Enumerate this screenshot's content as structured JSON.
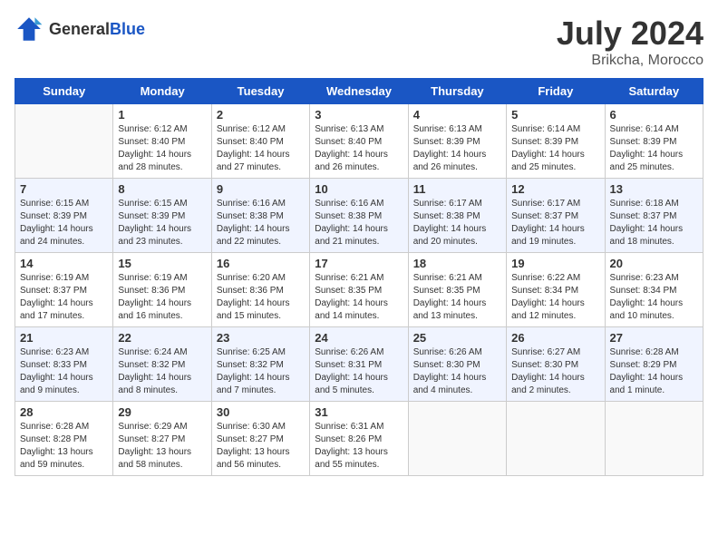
{
  "header": {
    "logo_general": "General",
    "logo_blue": "Blue",
    "month_year": "July 2024",
    "location": "Brikcha, Morocco"
  },
  "weekdays": [
    "Sunday",
    "Monday",
    "Tuesday",
    "Wednesday",
    "Thursday",
    "Friday",
    "Saturday"
  ],
  "weeks": [
    [
      {
        "day": "",
        "sunrise": "",
        "sunset": "",
        "daylight": ""
      },
      {
        "day": "1",
        "sunrise": "Sunrise: 6:12 AM",
        "sunset": "Sunset: 8:40 PM",
        "daylight": "Daylight: 14 hours and 28 minutes."
      },
      {
        "day": "2",
        "sunrise": "Sunrise: 6:12 AM",
        "sunset": "Sunset: 8:40 PM",
        "daylight": "Daylight: 14 hours and 27 minutes."
      },
      {
        "day": "3",
        "sunrise": "Sunrise: 6:13 AM",
        "sunset": "Sunset: 8:40 PM",
        "daylight": "Daylight: 14 hours and 26 minutes."
      },
      {
        "day": "4",
        "sunrise": "Sunrise: 6:13 AM",
        "sunset": "Sunset: 8:39 PM",
        "daylight": "Daylight: 14 hours and 26 minutes."
      },
      {
        "day": "5",
        "sunrise": "Sunrise: 6:14 AM",
        "sunset": "Sunset: 8:39 PM",
        "daylight": "Daylight: 14 hours and 25 minutes."
      },
      {
        "day": "6",
        "sunrise": "Sunrise: 6:14 AM",
        "sunset": "Sunset: 8:39 PM",
        "daylight": "Daylight: 14 hours and 25 minutes."
      }
    ],
    [
      {
        "day": "7",
        "sunrise": "Sunrise: 6:15 AM",
        "sunset": "Sunset: 8:39 PM",
        "daylight": "Daylight: 14 hours and 24 minutes."
      },
      {
        "day": "8",
        "sunrise": "Sunrise: 6:15 AM",
        "sunset": "Sunset: 8:39 PM",
        "daylight": "Daylight: 14 hours and 23 minutes."
      },
      {
        "day": "9",
        "sunrise": "Sunrise: 6:16 AM",
        "sunset": "Sunset: 8:38 PM",
        "daylight": "Daylight: 14 hours and 22 minutes."
      },
      {
        "day": "10",
        "sunrise": "Sunrise: 6:16 AM",
        "sunset": "Sunset: 8:38 PM",
        "daylight": "Daylight: 14 hours and 21 minutes."
      },
      {
        "day": "11",
        "sunrise": "Sunrise: 6:17 AM",
        "sunset": "Sunset: 8:38 PM",
        "daylight": "Daylight: 14 hours and 20 minutes."
      },
      {
        "day": "12",
        "sunrise": "Sunrise: 6:17 AM",
        "sunset": "Sunset: 8:37 PM",
        "daylight": "Daylight: 14 hours and 19 minutes."
      },
      {
        "day": "13",
        "sunrise": "Sunrise: 6:18 AM",
        "sunset": "Sunset: 8:37 PM",
        "daylight": "Daylight: 14 hours and 18 minutes."
      }
    ],
    [
      {
        "day": "14",
        "sunrise": "Sunrise: 6:19 AM",
        "sunset": "Sunset: 8:37 PM",
        "daylight": "Daylight: 14 hours and 17 minutes."
      },
      {
        "day": "15",
        "sunrise": "Sunrise: 6:19 AM",
        "sunset": "Sunset: 8:36 PM",
        "daylight": "Daylight: 14 hours and 16 minutes."
      },
      {
        "day": "16",
        "sunrise": "Sunrise: 6:20 AM",
        "sunset": "Sunset: 8:36 PM",
        "daylight": "Daylight: 14 hours and 15 minutes."
      },
      {
        "day": "17",
        "sunrise": "Sunrise: 6:21 AM",
        "sunset": "Sunset: 8:35 PM",
        "daylight": "Daylight: 14 hours and 14 minutes."
      },
      {
        "day": "18",
        "sunrise": "Sunrise: 6:21 AM",
        "sunset": "Sunset: 8:35 PM",
        "daylight": "Daylight: 14 hours and 13 minutes."
      },
      {
        "day": "19",
        "sunrise": "Sunrise: 6:22 AM",
        "sunset": "Sunset: 8:34 PM",
        "daylight": "Daylight: 14 hours and 12 minutes."
      },
      {
        "day": "20",
        "sunrise": "Sunrise: 6:23 AM",
        "sunset": "Sunset: 8:34 PM",
        "daylight": "Daylight: 14 hours and 10 minutes."
      }
    ],
    [
      {
        "day": "21",
        "sunrise": "Sunrise: 6:23 AM",
        "sunset": "Sunset: 8:33 PM",
        "daylight": "Daylight: 14 hours and 9 minutes."
      },
      {
        "day": "22",
        "sunrise": "Sunrise: 6:24 AM",
        "sunset": "Sunset: 8:32 PM",
        "daylight": "Daylight: 14 hours and 8 minutes."
      },
      {
        "day": "23",
        "sunrise": "Sunrise: 6:25 AM",
        "sunset": "Sunset: 8:32 PM",
        "daylight": "Daylight: 14 hours and 7 minutes."
      },
      {
        "day": "24",
        "sunrise": "Sunrise: 6:26 AM",
        "sunset": "Sunset: 8:31 PM",
        "daylight": "Daylight: 14 hours and 5 minutes."
      },
      {
        "day": "25",
        "sunrise": "Sunrise: 6:26 AM",
        "sunset": "Sunset: 8:30 PM",
        "daylight": "Daylight: 14 hours and 4 minutes."
      },
      {
        "day": "26",
        "sunrise": "Sunrise: 6:27 AM",
        "sunset": "Sunset: 8:30 PM",
        "daylight": "Daylight: 14 hours and 2 minutes."
      },
      {
        "day": "27",
        "sunrise": "Sunrise: 6:28 AM",
        "sunset": "Sunset: 8:29 PM",
        "daylight": "Daylight: 14 hours and 1 minute."
      }
    ],
    [
      {
        "day": "28",
        "sunrise": "Sunrise: 6:28 AM",
        "sunset": "Sunset: 8:28 PM",
        "daylight": "Daylight: 13 hours and 59 minutes."
      },
      {
        "day": "29",
        "sunrise": "Sunrise: 6:29 AM",
        "sunset": "Sunset: 8:27 PM",
        "daylight": "Daylight: 13 hours and 58 minutes."
      },
      {
        "day": "30",
        "sunrise": "Sunrise: 6:30 AM",
        "sunset": "Sunset: 8:27 PM",
        "daylight": "Daylight: 13 hours and 56 minutes."
      },
      {
        "day": "31",
        "sunrise": "Sunrise: 6:31 AM",
        "sunset": "Sunset: 8:26 PM",
        "daylight": "Daylight: 13 hours and 55 minutes."
      },
      {
        "day": "",
        "sunrise": "",
        "sunset": "",
        "daylight": ""
      },
      {
        "day": "",
        "sunrise": "",
        "sunset": "",
        "daylight": ""
      },
      {
        "day": "",
        "sunrise": "",
        "sunset": "",
        "daylight": ""
      }
    ]
  ]
}
